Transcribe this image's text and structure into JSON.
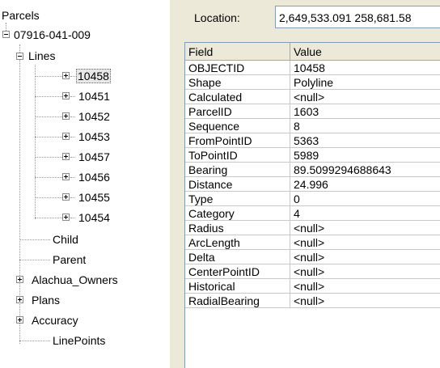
{
  "tree": {
    "root": "Parcels",
    "parcel": "07916-041-009",
    "lines_folder": "Lines",
    "line_items": [
      "10458",
      "10451",
      "10452",
      "10453",
      "10457",
      "10456",
      "10455",
      "10454"
    ],
    "selected": "10458",
    "child": "Child",
    "parent": "Parent",
    "alachua_owners": "Alachua_Owners",
    "plans": "Plans",
    "accuracy": "Accuracy",
    "linepoints": "LinePoints"
  },
  "location": {
    "label": "Location:",
    "value": "2,649,533.091  258,681.58"
  },
  "grid": {
    "headers": [
      "Field",
      "Value"
    ],
    "rows": [
      [
        "OBJECTID",
        "10458"
      ],
      [
        "Shape",
        "Polyline"
      ],
      [
        "Calculated",
        "<null>"
      ],
      [
        "ParcelID",
        "1603"
      ],
      [
        "Sequence",
        "8"
      ],
      [
        "FromPointID",
        "5363"
      ],
      [
        "ToPointID",
        "5989"
      ],
      [
        "Bearing",
        "89.5099294688643"
      ],
      [
        "Distance",
        "24.996"
      ],
      [
        "Type",
        "0"
      ],
      [
        "Category",
        "4"
      ],
      [
        "Radius",
        "<null>"
      ],
      [
        "ArcLength",
        "<null>"
      ],
      [
        "Delta",
        "<null>"
      ],
      [
        "CenterPointID",
        "<null>"
      ],
      [
        "Historical",
        "<null>"
      ],
      [
        "RadialBearing",
        "<null>"
      ]
    ]
  }
}
